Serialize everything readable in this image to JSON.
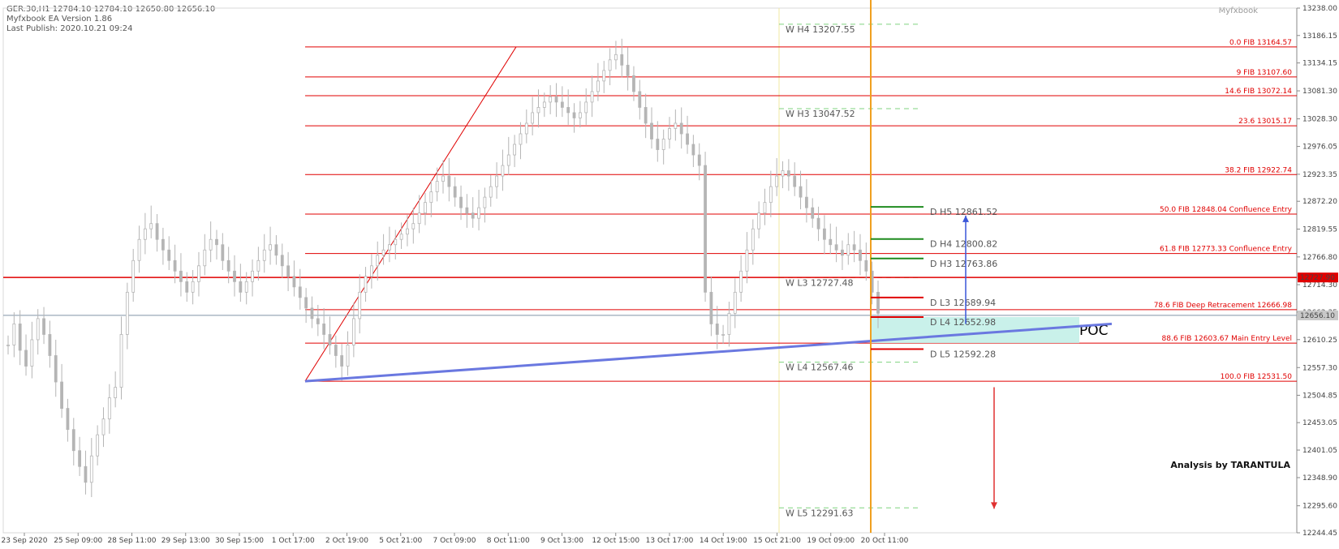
{
  "header": {
    "symbol_line": "GER.30,H1  12784.10 12784.10 12650.80 12656.10",
    "ea_version": "Myfxbook EA Version 1.86",
    "last_publish": "Last Publish: 2020.10.21 09:24",
    "brand": "Myfxbook"
  },
  "chart_data": {
    "type": "candlestick",
    "ylim": [
      12244.45,
      13238.0
    ],
    "y_ticks": [
      "13238.00",
      "13186.15",
      "13134.15",
      "13081.30",
      "13028.30",
      "12976.05",
      "12923.35",
      "12872.20",
      "12819.55",
      "12766.80",
      "12714.30",
      "12662.35",
      "12610.25",
      "12557.30",
      "12504.85",
      "12453.05",
      "12401.05",
      "12348.90",
      "12295.60",
      "12244.45"
    ],
    "x_ticks": [
      "23 Sep 2020",
      "25 Sep 09:00",
      "28 Sep 11:00",
      "29 Sep 13:00",
      "30 Sep 15:00",
      "1 Oct 17:00",
      "2 Oct 19:00",
      "5 Oct 21:00",
      "7 Oct 09:00",
      "8 Oct 11:00",
      "9 Oct 13:00",
      "12 Oct 15:00",
      "13 Oct 17:00",
      "14 Oct 19:00",
      "15 Oct 21:00",
      "19 Oct 09:00",
      "20 Oct 11:00"
    ],
    "fib_levels": [
      {
        "price": 13164.57,
        "label": "0.0 FIB 13164.57"
      },
      {
        "price": 13107.6,
        "label": "9 FIB 13107.60"
      },
      {
        "price": 13072.14,
        "label": "14.6 FIB 13072.14"
      },
      {
        "price": 13015.17,
        "label": "23.6  13015.17"
      },
      {
        "price": 12922.74,
        "label": "38.2 FIB 12922.74"
      },
      {
        "price": 12848.04,
        "label": "50.0 FIB 12848.04 Confluence Entry"
      },
      {
        "price": 12773.33,
        "label": "61.8 FIB 12773.33 Confluence Entry"
      },
      {
        "price": 12666.98,
        "label": "78.6 FIB Deep Retracement 12666.98"
      },
      {
        "price": 12603.67,
        "label": "88.6 FIB 12603.67 Main Entry Level"
      },
      {
        "price": 12531.5,
        "label": "100.0 FIB 12531.50"
      }
    ],
    "weekly_pivots": [
      {
        "price": 13207.55,
        "label": "W  H4 13207.55"
      },
      {
        "price": 13047.52,
        "label": "W  H3 13047.52"
      },
      {
        "price": 12727.48,
        "label": "W  L3 12727.48"
      },
      {
        "price": 12567.46,
        "label": "W  L4 12567.46"
      },
      {
        "price": 12291.63,
        "label": "W  L5 12291.63"
      }
    ],
    "daily_pivots": [
      {
        "price": 12861.52,
        "label": "D  H5 12861.52",
        "color": "#1f8b1f"
      },
      {
        "price": 12800.82,
        "label": "D  H4 12800.82",
        "color": "#1f8b1f"
      },
      {
        "price": 12763.86,
        "label": "D  H3 12763.86",
        "color": "#1f8b1f"
      },
      {
        "price": 12689.94,
        "label": "D  L3 12689.94",
        "color": "#e00000"
      },
      {
        "price": 12652.98,
        "label": "D  L4 12652.98",
        "color": "#e00000"
      },
      {
        "price": 12592.28,
        "label": "D  L5 12592.28",
        "color": "#e00000"
      }
    ],
    "current_price": "12656.10",
    "marked_price": "12727.90",
    "poc_label": "POC",
    "annotation": "Analysis by TARANTULA",
    "closes": [
      12600,
      12640,
      12590,
      12560,
      12610,
      12650,
      12620,
      12580,
      12530,
      12480,
      12440,
      12400,
      12370,
      12340,
      12390,
      12430,
      12460,
      12500,
      12520,
      12620,
      12700,
      12760,
      12800,
      12820,
      12830,
      12800,
      12780,
      12760,
      12740,
      12720,
      12700,
      12720,
      12750,
      12780,
      12800,
      12790,
      12760,
      12740,
      12720,
      12700,
      12720,
      12740,
      12760,
      12780,
      12790,
      12770,
      12750,
      12730,
      12710,
      12690,
      12670,
      12650,
      12640,
      12620,
      12600,
      12580,
      12560,
      12600,
      12650,
      12700,
      12730,
      12750,
      12770,
      12780,
      12790,
      12800,
      12810,
      12820,
      12830,
      12850,
      12870,
      12890,
      12910,
      12920,
      12900,
      12880,
      12860,
      12850,
      12840,
      12860,
      12880,
      12900,
      12920,
      12940,
      12960,
      12980,
      13000,
      13020,
      13040,
      13050,
      13060,
      13070,
      13060,
      13050,
      13040,
      13030,
      13040,
      13060,
      13080,
      13100,
      13120,
      13140,
      13150,
      13130,
      13110,
      13080,
      13050,
      13020,
      12990,
      12970,
      12990,
      13010,
      13020,
      13000,
      12980,
      12960,
      12940,
      12700,
      12640,
      12620,
      12620,
      12660,
      12700,
      12740,
      12780,
      12820,
      12850,
      12870,
      12900,
      12920,
      12930,
      12920,
      12900,
      12880,
      12860,
      12840,
      12820,
      12800,
      12790,
      12780,
      12770,
      12790,
      12780,
      12760,
      12740,
      12700,
      12660
    ]
  }
}
